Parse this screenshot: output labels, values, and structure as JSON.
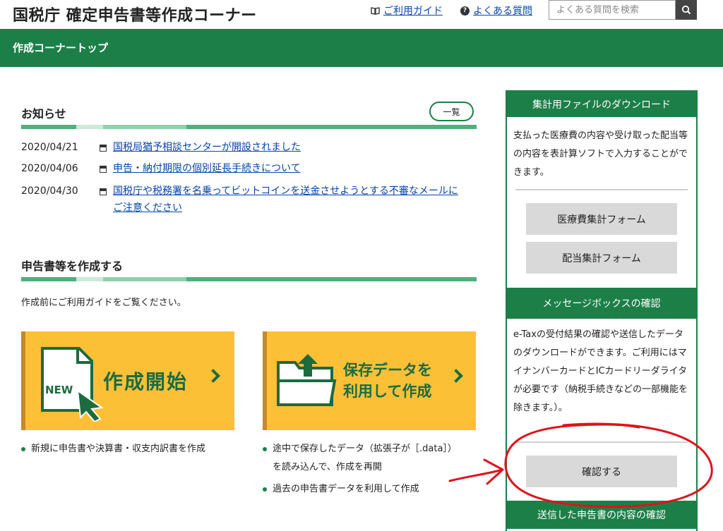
{
  "header": {
    "site_title": "国税庁 確定申告書等作成コーナー",
    "guide_link": "ご利用ガイド",
    "faq_link": "よくある質問",
    "search_placeholder": "よくある質問を検索"
  },
  "band": {
    "title": "作成コーナートップ"
  },
  "news": {
    "heading": "お知らせ",
    "list_button": "一覧",
    "items": [
      {
        "date": "2020/04/21",
        "title": "国税局猶予相談センターが開設されました"
      },
      {
        "date": "2020/04/06",
        "title": "申告・納付期限の個別延長手続きについて"
      },
      {
        "date": "2020/04/30",
        "title": "国税庁や税務署を名乗ってビットコインを送金させようとする不審なメールにご注意ください"
      }
    ]
  },
  "create": {
    "heading": "申告書等を作成する",
    "guide_text": "作成前にご利用ガイドをご覧ください。",
    "start": {
      "badge": "NEW",
      "label": "作成開始",
      "bullet": "新規に申告書や決算書・収支内訳書を作成"
    },
    "saved": {
      "label_line1": "保存データを",
      "label_line2": "利用して作成",
      "bullet1_line1": "途中で保存したデータ（拡張子が［.data］）",
      "bullet1_line2": "を読み込んで、作成を再開",
      "bullet2": "過去の申告書データを利用して作成"
    }
  },
  "sidebar": {
    "download": {
      "heading": "集計用ファイルのダウンロード",
      "text": "支払った医療費の内容や受け取った配当等の内容を表計算ソフトで入力することができます。",
      "medical_button": "医療費集計フォーム",
      "dividend_button": "配当集計フォーム"
    },
    "message_box": {
      "heading": "メッセージボックスの確認",
      "text": "e-Taxの受付結果の確認や送信したデータのダウンロードができます。ご利用にはマイナンバーカードとICカードリーダライタが必要です（納税手続きなどの一部機能を除きます。）。",
      "confirm_button": "確認する"
    },
    "sent": {
      "heading": "送信した申告書の内容の確認"
    }
  },
  "colors": {
    "brand_green": "#1d7f48",
    "button_yellow": "#fcc037",
    "annotation_red": "#e0121b"
  }
}
